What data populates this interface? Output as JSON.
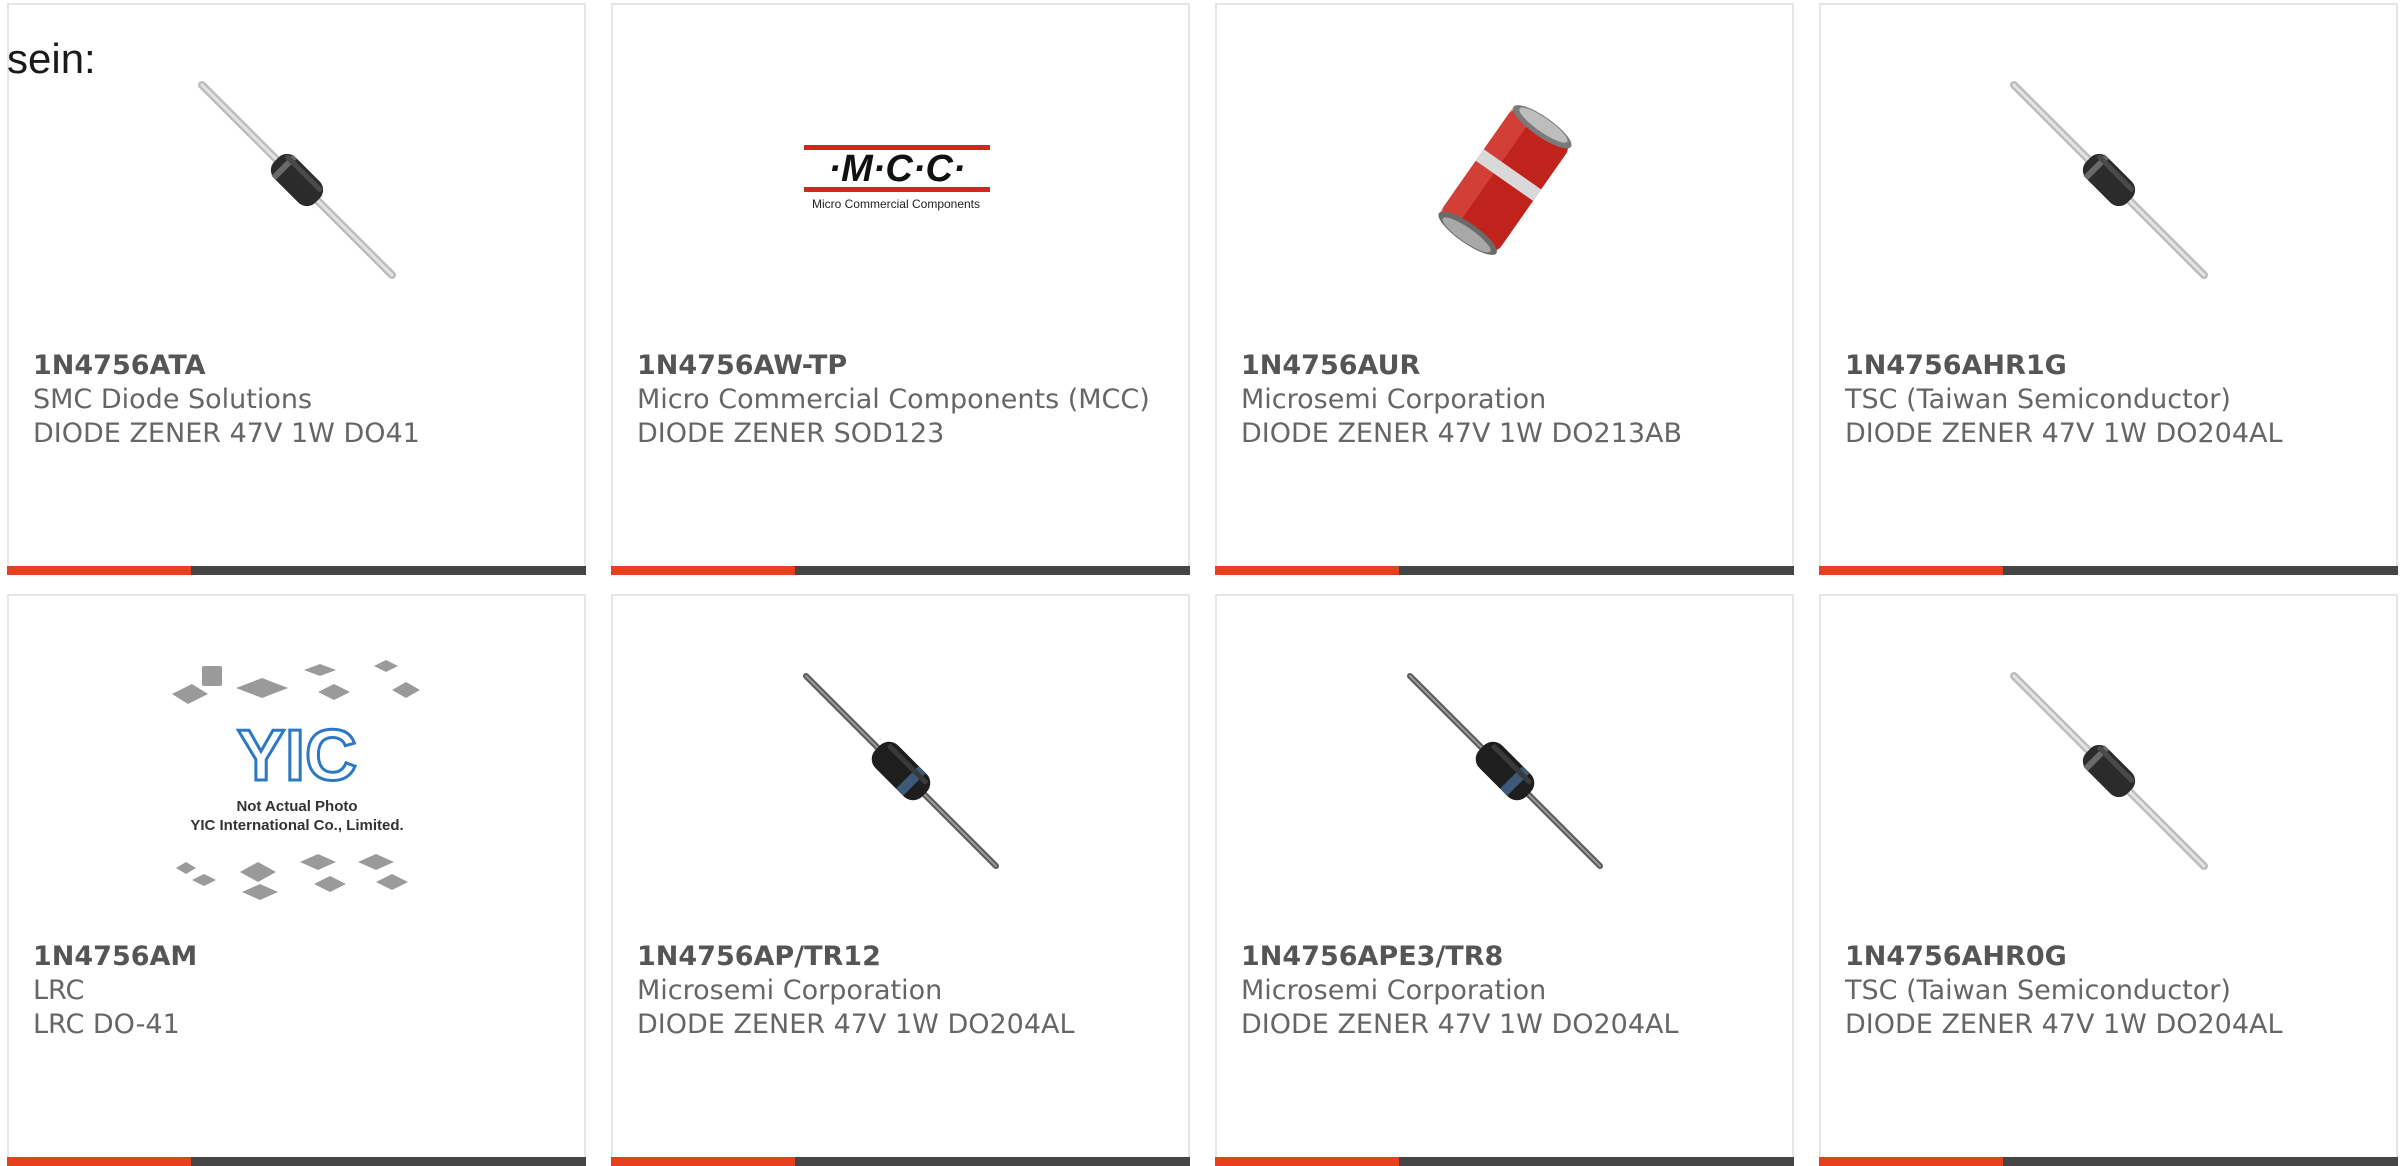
{
  "intro_text": "sein:",
  "colors": {
    "accent": "#e8401c",
    "bar_dark": "#454545",
    "text_muted": "#666666"
  },
  "products": [
    {
      "part": "1N4756ATA",
      "manufacturer": "SMC Diode Solutions",
      "description": "DIODE ZENER 47V 1W DO41",
      "image_icon": "axial-diode-gray-icon"
    },
    {
      "part": "1N4756AW-TP",
      "manufacturer": "Micro Commercial Components (MCC)",
      "description": "DIODE ZENER SOD123",
      "image_icon": "mcc-logo-icon",
      "logo_text": "·M·C·C·",
      "logo_subtext": "Micro Commercial Components"
    },
    {
      "part": "1N4756AUR",
      "manufacturer": "Microsemi Corporation",
      "description": "DIODE ZENER 47V 1W DO213AB",
      "image_icon": "melf-diode-red-icon"
    },
    {
      "part": "1N4756AHR1G",
      "manufacturer": "TSC (Taiwan Semiconductor)",
      "description": "DIODE ZENER 47V 1W DO204AL",
      "image_icon": "axial-diode-gray-icon"
    },
    {
      "part": "1N4756AM",
      "manufacturer": "LRC",
      "description": "LRC DO-41",
      "image_icon": "yic-placeholder-icon",
      "logo_text": "YIC",
      "logo_subtext": "Not Actual Photo",
      "logo_subtext2": "YIC International Co., Limited."
    },
    {
      "part": "1N4756AP/TR12",
      "manufacturer": "Microsemi Corporation",
      "description": "DIODE ZENER 47V 1W DO204AL",
      "image_icon": "axial-diode-dark-icon"
    },
    {
      "part": "1N4756APE3/TR8",
      "manufacturer": "Microsemi Corporation",
      "description": "DIODE ZENER 47V 1W DO204AL",
      "image_icon": "axial-diode-dark-icon"
    },
    {
      "part": "1N4756AHR0G",
      "manufacturer": "TSC (Taiwan Semiconductor)",
      "description": "DIODE ZENER 47V 1W DO204AL",
      "image_icon": "axial-diode-gray-icon"
    }
  ]
}
